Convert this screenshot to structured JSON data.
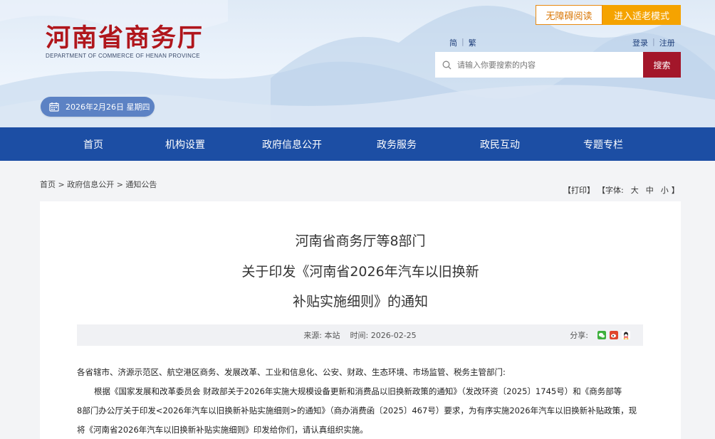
{
  "site": {
    "name_cn": "河南省商务厅",
    "name_en": "DEPARTMENT OF COMMERCE OF HENAN PROVINCE"
  },
  "topbar": {
    "accessible_label": "无障碍阅读",
    "elder_label": "进入适老模式",
    "lang_simplified": "简",
    "lang_traditional": "繁",
    "login": "登录",
    "register": "注册"
  },
  "search": {
    "placeholder": "请输入你要搜索的内容",
    "button": "搜索"
  },
  "date": "2026年2月26日 星期四",
  "nav": [
    "首页",
    "机构设置",
    "政府信息公开",
    "政务服务",
    "政民互动",
    "专题专栏"
  ],
  "breadcrumb": "首页 > 政府信息公开 > 通知公告",
  "tools": {
    "print": "【打印】",
    "font_label": "【字体:",
    "large": "大",
    "medium": "中",
    "small": "小",
    "close": "】"
  },
  "article": {
    "title_line1": "河南省商务厅等8部门",
    "title_line2": "关于印发《河南省2026年汽车以旧换新",
    "title_line3": "补贴实施细则》的通知",
    "source_label": "来源:",
    "source_value": "本站",
    "time_label": "时间:",
    "time_value": "2026-02-25",
    "share_label": "分享:",
    "salutation": "各省辖市、济源示范区、航空港区商务、发展改革、工业和信息化、公安、财政、生态环境、市场监管、税务主管部门:",
    "para1_line1": "根据《国家发展和改革委员会 财政部关于2026年实施大规模设备更新和消费品以旧换新政策的通知》（发改环资〔2025〕1745号）和《商务部等",
    "para1_line2": "8部门办公厅关于印发<2026年汽车以旧换新补贴实施细则>的通知》（商办消费函〔2025〕467号）要求，为有序实施2026年汽车以旧换新补贴政策，现",
    "para1_line3": "将《河南省2026年汽车以旧换新补贴实施细则》印发给你们，请认真组织实施。"
  },
  "colors": {
    "nav_bg": "#1c4ea4",
    "logo_red": "#b0161c",
    "search_btn": "#a3162a",
    "elder_btn": "#f5a300"
  }
}
